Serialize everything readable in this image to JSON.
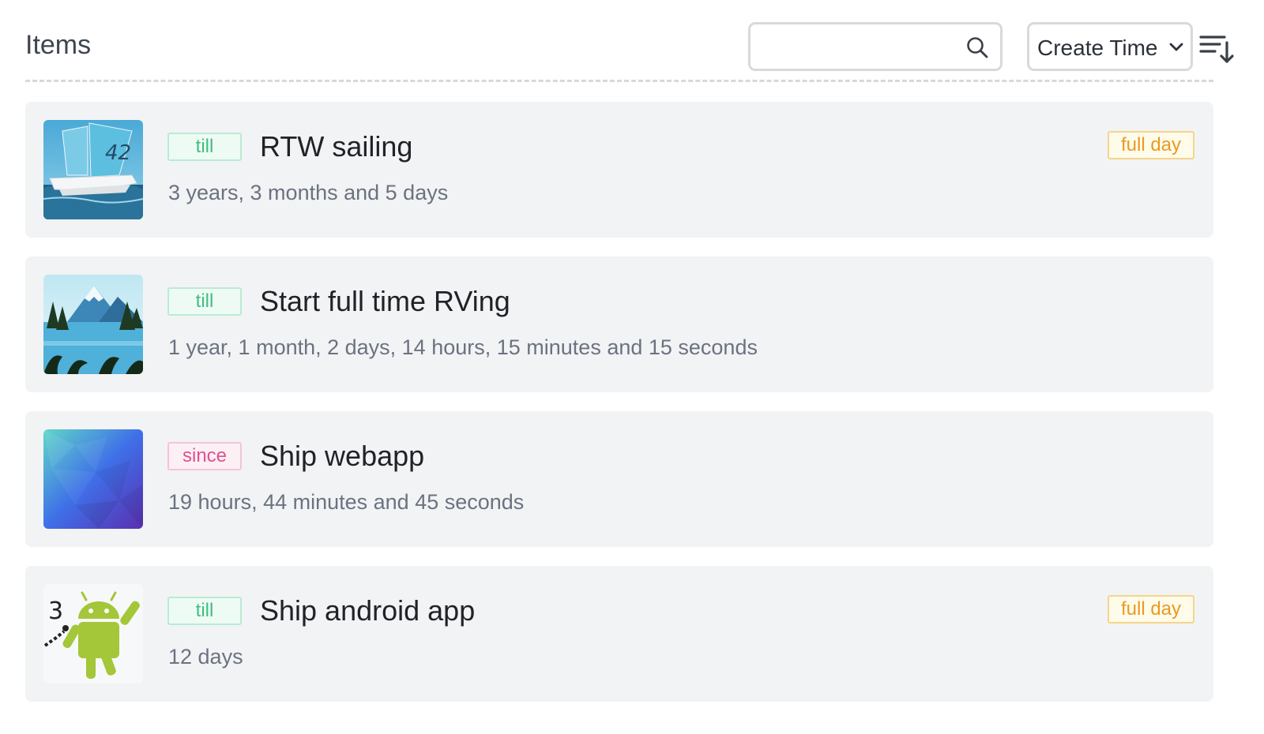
{
  "header": {
    "title": "Items",
    "search": {
      "value": "",
      "placeholder": ""
    },
    "sort": {
      "selected": "Create Time"
    }
  },
  "items": [
    {
      "type": "till",
      "title": "RTW sailing",
      "duration": "3 years, 3 months and 5 days",
      "full_day": "full day",
      "thumbnail": "sailing-catamaran-image"
    },
    {
      "type": "till",
      "title": "Start full time RVing",
      "duration": "1 year, 1 month, 2 days, 14 hours, 15 minutes and 15 seconds",
      "full_day": "",
      "thumbnail": "mountain-lake-image"
    },
    {
      "type": "since",
      "title": "Ship webapp",
      "duration": "19 hours, 44 minutes and 45 seconds",
      "full_day": "",
      "thumbnail": "blue-gradient-image"
    },
    {
      "type": "till",
      "title": "Ship android app",
      "duration": "12 days",
      "full_day": "full day",
      "thumbnail": "android-robot-image"
    }
  ],
  "colors": {
    "till": "#3fbf7f",
    "since": "#e0508c",
    "full_day": "#e89b20",
    "card_bg": "#f2f3f5"
  }
}
